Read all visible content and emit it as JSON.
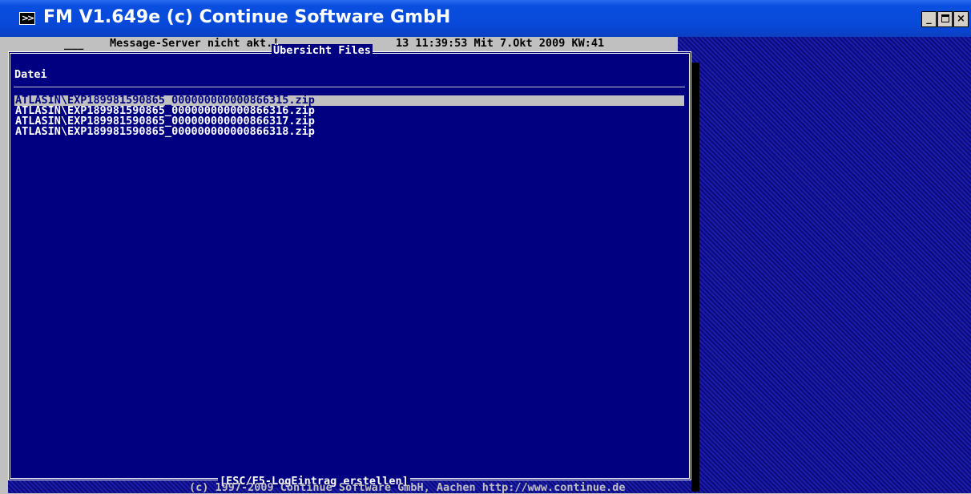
{
  "window": {
    "title": "FM V1.649e (c) Continue Software GmbH",
    "icon": "dos-app-icon",
    "buttons": {
      "minimize": "_",
      "maximize": "□",
      "close": "×"
    }
  },
  "status": {
    "dash": "___",
    "message": "Message-Server nicht akt.!",
    "datetime": "13 11:39:53 Mit 7.Okt 2009 KW:41"
  },
  "dialog": {
    "title": "Übersicht Files",
    "column_header": "Datei",
    "files": [
      "ATLASIN\\EXP189981590865_000000000000866315.zip",
      "ATLASIN\\EXP189981590865_000000000000866316.zip",
      "ATLASIN\\EXP189981590865_000000000000866317.zip",
      "ATLASIN\\EXP189981590865_000000000000866318.zip"
    ],
    "selected_index": 0,
    "footer": "[ESC/F5-LogEintrag erstellen]"
  },
  "copyright": "(c) 1997-2009 Continue Software GmbH, Aachen http://www.continue.de",
  "colors": {
    "titlebar": "#0848d8",
    "dialog_bg": "#000080",
    "selection": "#c0c0c0",
    "text": "#ffffff"
  }
}
